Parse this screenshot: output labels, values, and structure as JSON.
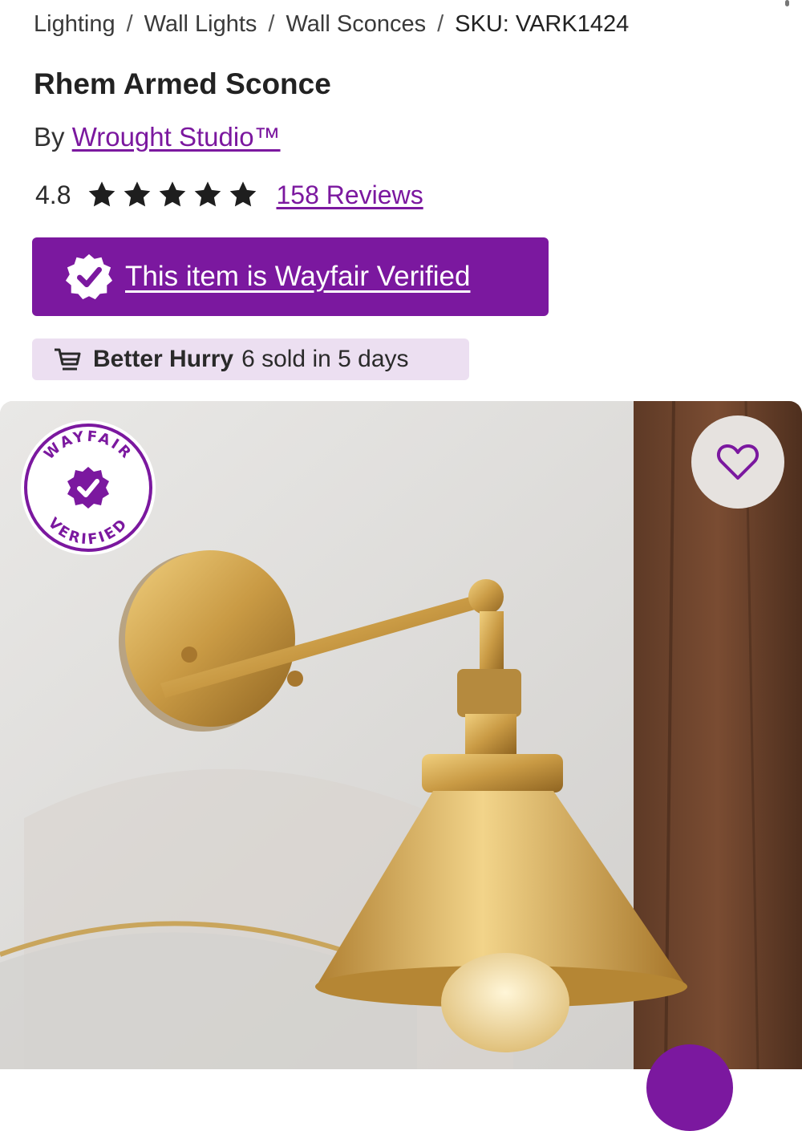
{
  "breadcrumb": {
    "items": [
      "Lighting",
      "Wall Lights",
      "Wall Sconces"
    ],
    "separator": "/",
    "sku": "SKU: VARK1424"
  },
  "product": {
    "title": "Rhem Armed Sconce",
    "by_prefix": "By",
    "brand": "Wrought Studio™",
    "rating": "4.8",
    "stars_filled": 5,
    "reviews_link": "158 Reviews"
  },
  "verified_banner": {
    "text": "This item is Wayfair Verified",
    "badge_icon": "verified-check-badge-icon",
    "color": "#7b189f"
  },
  "urgency": {
    "icon": "cart-icon",
    "bold": "Better Hurry",
    "text": "6 sold in 5 days",
    "background": "#ecdff1"
  },
  "gallery": {
    "stamp_top": "WAYFAIR",
    "stamp_bottom": "VERIFIED",
    "favorite_icon": "heart-icon"
  }
}
